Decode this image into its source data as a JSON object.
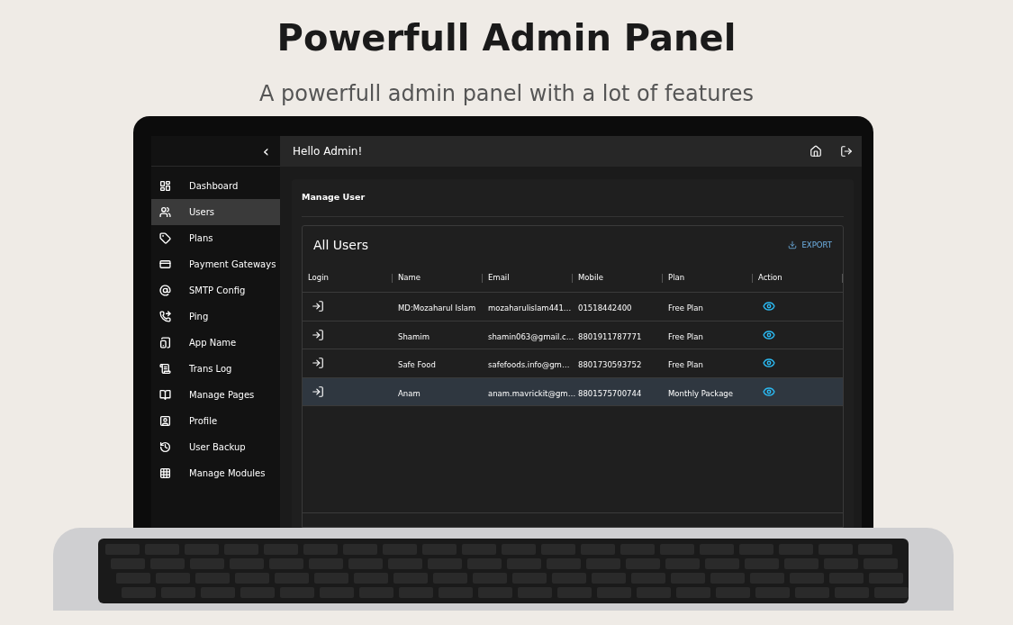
{
  "headline": {
    "title": "Powerfull Admin Panel",
    "subtitle": "A powerfull admin panel with a lot of features"
  },
  "sidebar": {
    "collapse_glyph": "‹",
    "items": [
      {
        "label": "Dashboard",
        "selected": false
      },
      {
        "label": "Users",
        "selected": true
      },
      {
        "label": "Plans",
        "selected": false
      },
      {
        "label": "Payment Gateways",
        "selected": false
      },
      {
        "label": "SMTP Config",
        "selected": false
      },
      {
        "label": "Ping",
        "selected": false
      },
      {
        "label": "App Name",
        "selected": false
      },
      {
        "label": "Trans Log",
        "selected": false
      },
      {
        "label": "Manage Pages",
        "selected": false
      },
      {
        "label": "Profile",
        "selected": false
      },
      {
        "label": "User Backup",
        "selected": false
      },
      {
        "label": "Manage Modules",
        "selected": false
      }
    ]
  },
  "topbar": {
    "greeting": "Hello Admin!"
  },
  "page": {
    "title": "Manage User"
  },
  "table": {
    "title": "All Users",
    "export_label": "EXPORT",
    "columns": [
      "Login",
      "Name",
      "Email",
      "Mobile",
      "Plan",
      "Action"
    ],
    "rows": [
      {
        "name": "MD:Mozaharul Islam",
        "email": "mozaharulislam441…",
        "mobile": "01518442400",
        "plan": "Free Plan",
        "selected": false
      },
      {
        "name": "Shamim",
        "email": "shamin063@gmail.c…",
        "mobile": "8801911787771",
        "plan": "Free Plan",
        "selected": false
      },
      {
        "name": "Safe Food",
        "email": "safefoods.info@gm…",
        "mobile": "8801730593752",
        "plan": "Free Plan",
        "selected": false
      },
      {
        "name": "Anam",
        "email": "anam.mavrickit@gm…",
        "mobile": "8801575700744",
        "plan": "Monthly Package",
        "selected": true
      }
    ]
  }
}
